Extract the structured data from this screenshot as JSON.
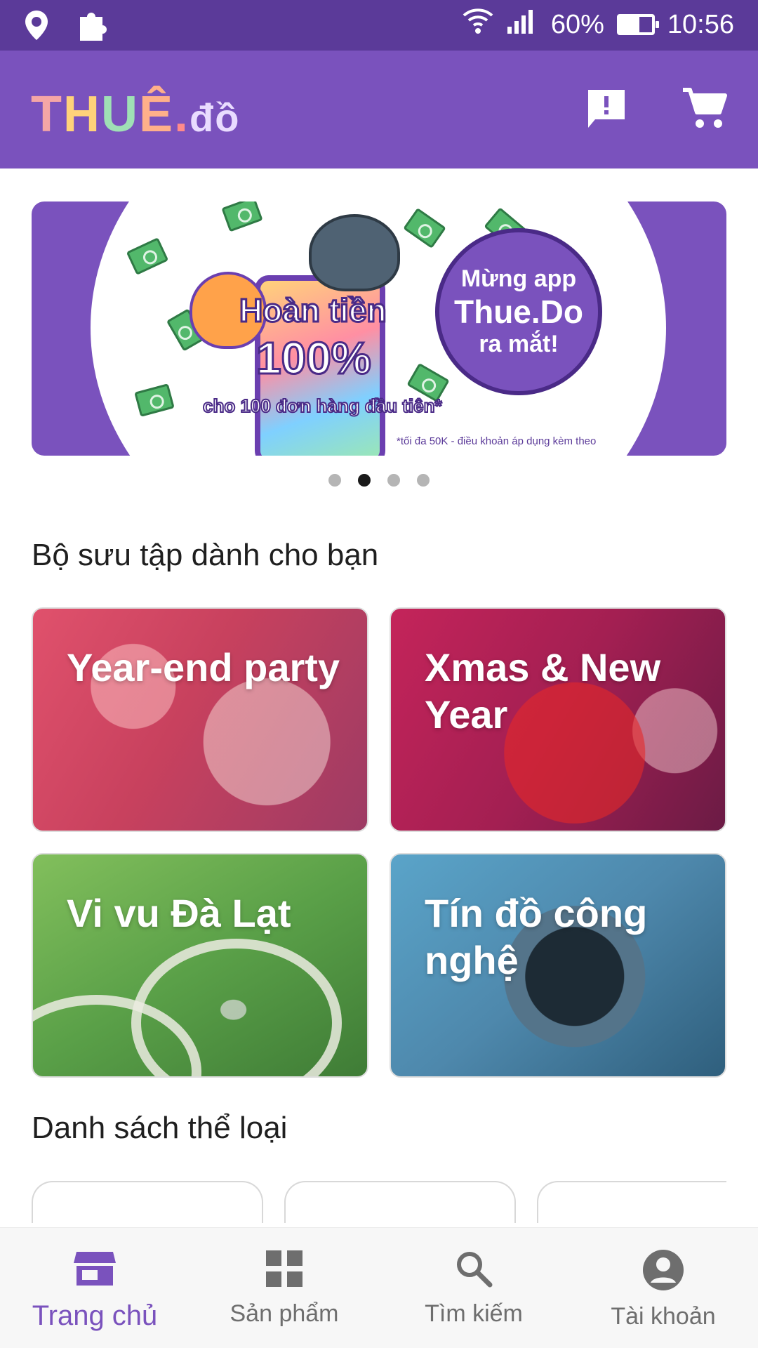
{
  "status_bar": {
    "battery": "60%",
    "battery_level": 0.6,
    "time": "10:56",
    "icons": [
      "location-icon",
      "puzzle-icon",
      "wifi-icon",
      "signal-icon",
      "battery-icon"
    ]
  },
  "app_bar": {
    "logo_text": "THUÊ.đồ",
    "icons": [
      "feedback-icon",
      "cart-icon"
    ]
  },
  "banner": {
    "headline_line1": "Hoàn tiền",
    "headline_line2": "100%",
    "headline_line3": "cho 100 đơn hàng đầu tiên*",
    "bubble_line1": "Mừng app",
    "bubble_line2": "Thue.Do",
    "bubble_line3": "ra mắt!",
    "footnote": "*tối đa 50K - điều khoản áp dụng kèm theo",
    "slide_count": 4,
    "active_slide": 2
  },
  "collections": {
    "title": "Bộ sưu tập dành cho bạn",
    "items": [
      {
        "label": "Year-end party"
      },
      {
        "label": "Xmas & New Year"
      },
      {
        "label": "Vi vu Đà Lạt"
      },
      {
        "label": "Tín đồ công nghệ"
      }
    ]
  },
  "categories": {
    "title": "Danh sách thể loại"
  },
  "bottom_nav": {
    "items": [
      {
        "label": "Trang chủ",
        "icon": "store-icon",
        "active": true
      },
      {
        "label": "Sản phẩm",
        "icon": "grid-icon",
        "active": false
      },
      {
        "label": "Tìm kiếm",
        "icon": "search-icon",
        "active": false
      },
      {
        "label": "Tài khoản",
        "icon": "account-icon",
        "active": false
      }
    ]
  },
  "colors": {
    "primary": "#7a52bd",
    "status_bar": "#5b3a99",
    "active_dot": "#1a1a1a",
    "inactive_dot": "#b5b5b5"
  }
}
